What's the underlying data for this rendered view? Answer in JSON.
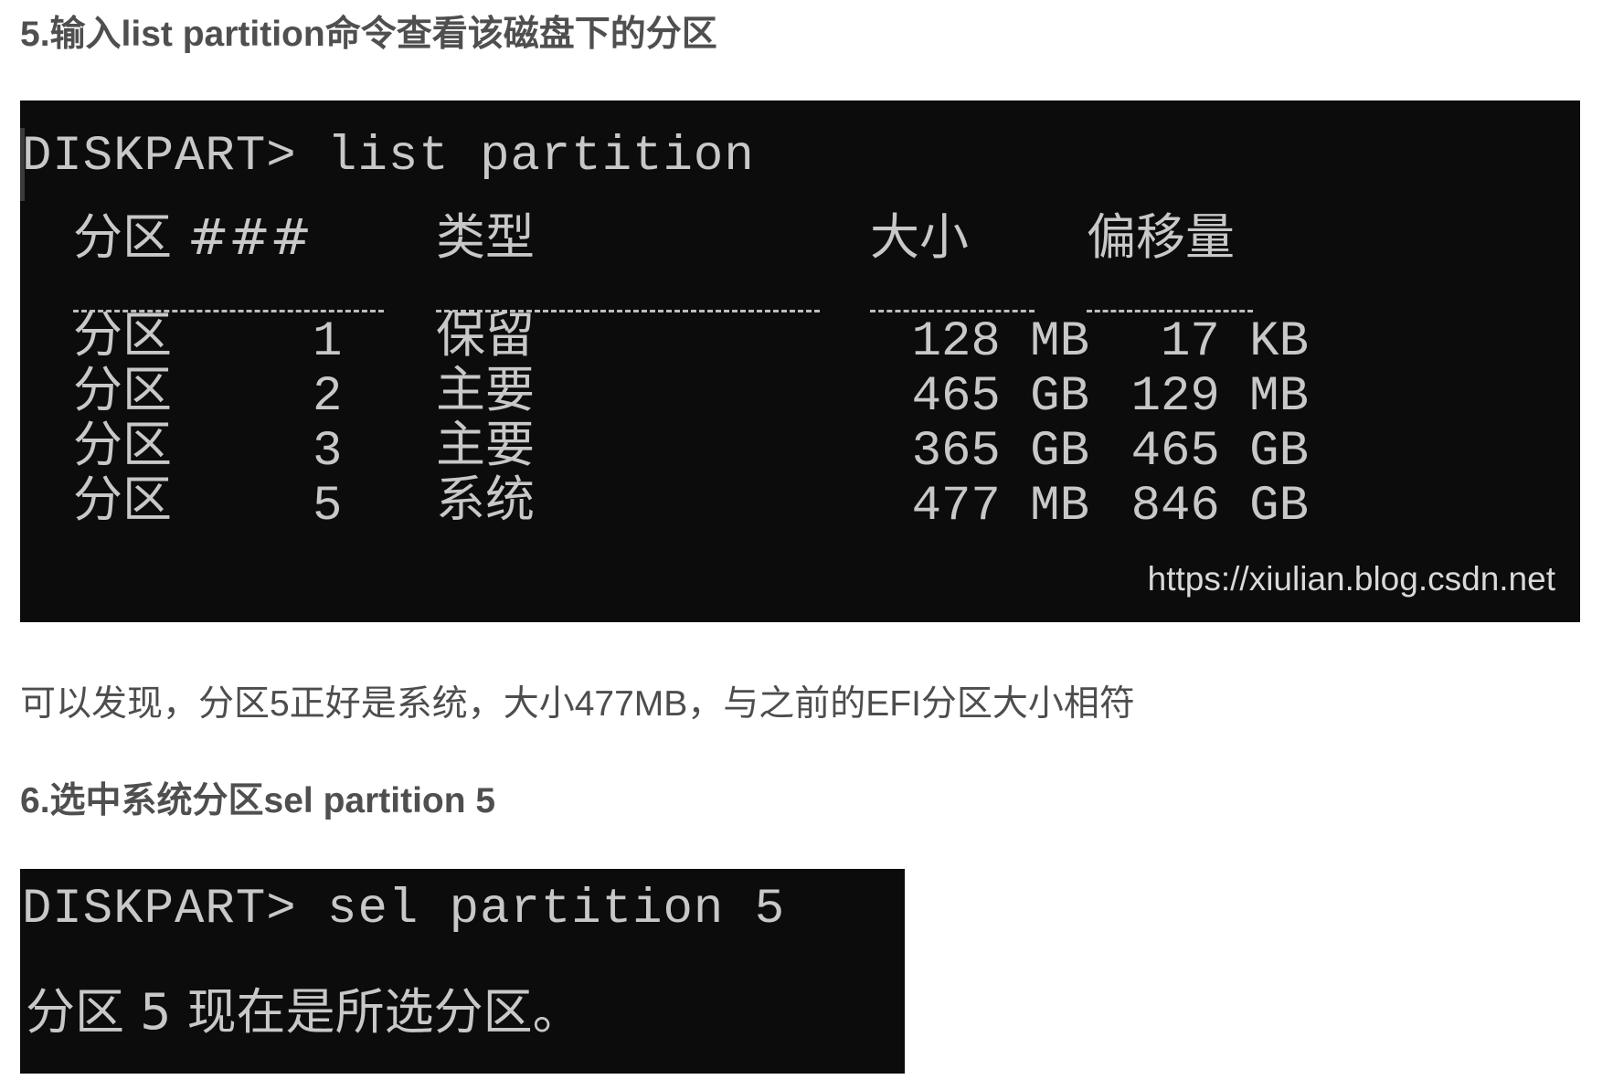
{
  "step5": {
    "heading": "5.输入list partition命令查看该磁盘下的分区"
  },
  "terminal1": {
    "command": "DISKPART> list partition",
    "headers": {
      "partition": "分区 ###",
      "type": "类型",
      "size": "大小",
      "offset": "偏移量"
    },
    "rows": [
      {
        "label": "分区",
        "num": "1",
        "type": "保留",
        "size": "128 MB",
        "offset": "17 KB"
      },
      {
        "label": "分区",
        "num": "2",
        "type": "主要",
        "size": "465 GB",
        "offset": "129 MB"
      },
      {
        "label": "分区",
        "num": "3",
        "type": "主要",
        "size": "365 GB",
        "offset": "465 GB"
      },
      {
        "label": "分区",
        "num": "5",
        "type": "系统",
        "size": "477 MB",
        "offset": "846 GB"
      }
    ],
    "watermark": "https://xiulian.blog.csdn.net"
  },
  "note": {
    "text": "可以发现，分区5正好是系统，大小477MB，与之前的EFI分区大小相符"
  },
  "step6": {
    "heading": "6.选中系统分区sel partition 5"
  },
  "terminal2": {
    "command": "DISKPART> sel partition 5",
    "result": "分区 5 现在是所选分区。"
  }
}
